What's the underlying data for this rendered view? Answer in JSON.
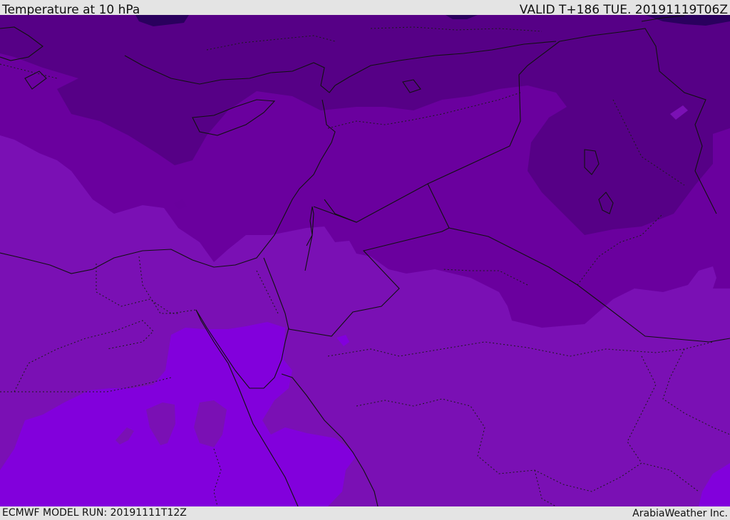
{
  "header": {
    "title": "Temperature at 10 hPa",
    "valid": "VALID T+186 TUE. 20191119T06Z"
  },
  "footer": {
    "model_run": "ECMWF MODEL RUN: 20191111T12Z",
    "credit": "ArabiaWeather Inc."
  },
  "colors": {
    "coldest": "#2a005e",
    "band_1": "#560086",
    "band_2": "#69009d",
    "band_3": "#7a10b4",
    "warmest": "#8200dc",
    "border": "#111111"
  }
}
